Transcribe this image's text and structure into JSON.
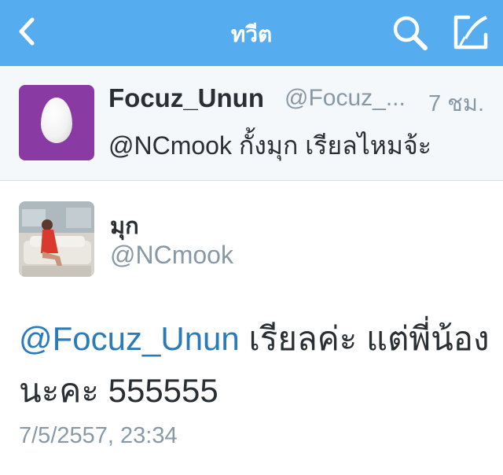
{
  "navbar": {
    "title": "ทวีต",
    "background": "#55acee",
    "icons": {
      "back": "chevron-left-icon",
      "search": "search-icon",
      "compose": "compose-icon"
    }
  },
  "reply_context": {
    "avatar": "default-egg-avatar",
    "avatar_color": "#8a3ba3",
    "name": "Focuz_Unun",
    "handle": "@Focuz_...",
    "time": "7 ชม.",
    "text": "@NCmook กั้งมุก เรียลไหมจ้ะ"
  },
  "tweet": {
    "avatar": "profile-photo",
    "name": "มุก",
    "handle": "@NCmook",
    "mention": "@Focuz_Unun",
    "text_line1_rest": " เรียลค่ะ แต่พี่น้อง",
    "text_line2_thai": "นะคะ",
    "text_line2_number": " 555555",
    "timestamp": "7/5/2557, 23:34",
    "link_color": "#2b7bb9"
  }
}
